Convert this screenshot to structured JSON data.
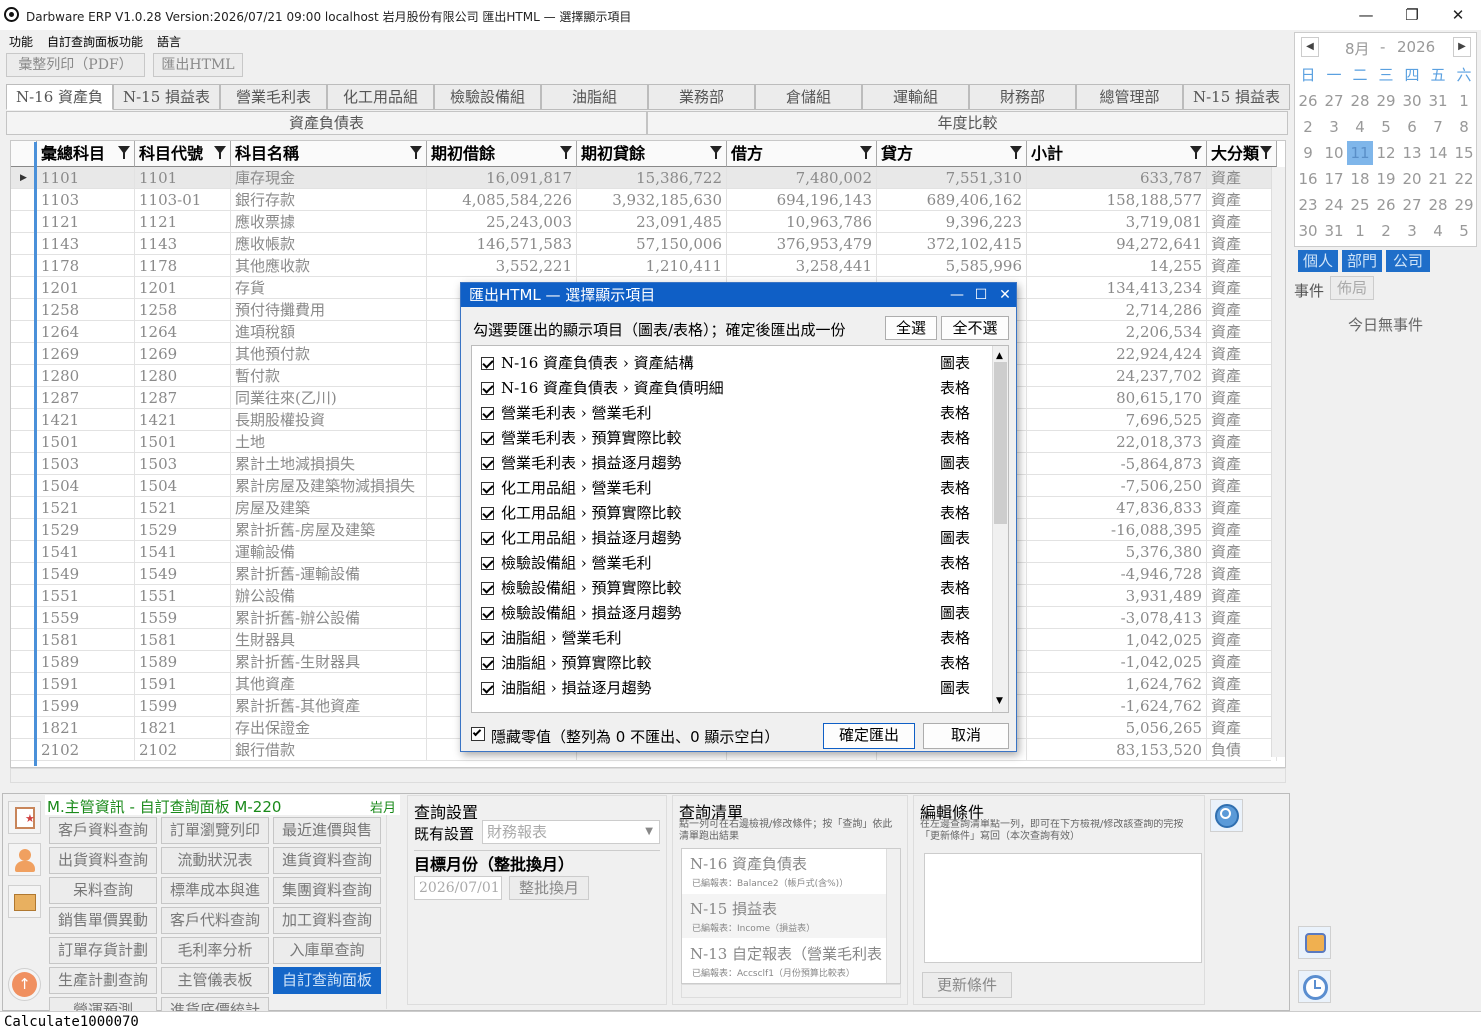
{
  "window": {
    "title": "Darbware ERP V1.0.28 Version:2026/07/21 09:00   localhost 岩月股份有限公司 匯出HTML — 選擇顯示項目",
    "minimize": "—",
    "maximize": "❐",
    "close": "✕"
  },
  "menu": [
    "功能",
    "自訂查詢面板功能",
    "語言"
  ],
  "toolbar": {
    "print": "彙整列印（PDF）",
    "export_html": "匯出HTML"
  },
  "tabs": [
    "N-16 資產負",
    "N-15 損益表",
    "營業毛利表",
    "化工用品組",
    "檢驗設備組",
    "油脂組",
    "業務部",
    "倉儲組",
    "運輸組",
    "財務部",
    "總管理部",
    "N-15 損益表"
  ],
  "group_headers": {
    "left": "資產負債表",
    "right": "年度比較"
  },
  "grid": {
    "columns": [
      "彙總科目",
      "科目代號",
      "科目名稱",
      "期初借餘",
      "期初貸餘",
      "借方",
      "貸方",
      "小計",
      "大分類"
    ],
    "row_marker": "▶",
    "rows": [
      [
        "1101",
        "1101",
        "庫存現金",
        "16,091,817",
        "15,386,722",
        "7,480,002",
        "7,551,310",
        "633,787",
        "資產"
      ],
      [
        "1103",
        "1103-01",
        "銀行存款",
        "4,085,584,226",
        "3,932,185,630",
        "694,196,143",
        "689,406,162",
        "158,188,577",
        "資產"
      ],
      [
        "1121",
        "1121",
        "應收票據",
        "25,243,003",
        "23,091,485",
        "10,963,786",
        "9,396,223",
        "3,719,081",
        "資產"
      ],
      [
        "1143",
        "1143",
        "應收帳款",
        "146,571,583",
        "57,150,006",
        "376,953,479",
        "372,102,415",
        "94,272,641",
        "資產"
      ],
      [
        "1178",
        "1178",
        "其他應收款",
        "3,552,221",
        "1,210,411",
        "3,258,441",
        "5,585,996",
        "14,255",
        "資產"
      ],
      [
        "1201",
        "1201",
        "存貨",
        "",
        "",
        "",
        "",
        "134,413,234",
        "資產"
      ],
      [
        "1258",
        "1258",
        "預付待攤費用",
        "",
        "",
        "",
        "",
        "2,714,286",
        "資產"
      ],
      [
        "1264",
        "1264",
        "進項稅額",
        "",
        "",
        "",
        "",
        "2,206,534",
        "資產"
      ],
      [
        "1269",
        "1269",
        "其他預付款",
        "",
        "",
        "",
        "",
        "22,924,424",
        "資產"
      ],
      [
        "1280",
        "1280",
        "暫付款",
        "",
        "",
        "",
        "",
        "24,237,702",
        "資產"
      ],
      [
        "1287",
        "1287",
        "同業往來(乙川)",
        "",
        "",
        "",
        "",
        "80,615,170",
        "資產"
      ],
      [
        "1421",
        "1421",
        "長期股權投資",
        "",
        "",
        "",
        "",
        "7,696,525",
        "資產"
      ],
      [
        "1501",
        "1501",
        "土地",
        "",
        "",
        "",
        "",
        "22,018,373",
        "資產"
      ],
      [
        "1503",
        "1503",
        "累計土地減損損失",
        "",
        "",
        "",
        "",
        "-5,864,873",
        "資產"
      ],
      [
        "1504",
        "1504",
        "累計房屋及建築物減損損失",
        "",
        "",
        "",
        "",
        "-7,506,250",
        "資產"
      ],
      [
        "1521",
        "1521",
        "房屋及建築",
        "",
        "",
        "",
        "",
        "47,836,833",
        "資產"
      ],
      [
        "1529",
        "1529",
        "累計折舊-房屋及建築",
        "",
        "",
        "",
        "",
        "-16,088,395",
        "資產"
      ],
      [
        "1541",
        "1541",
        "運輸設備",
        "",
        "",
        "",
        "",
        "5,376,380",
        "資產"
      ],
      [
        "1549",
        "1549",
        "累計折舊-運輸設備",
        "",
        "",
        "",
        "",
        "-4,946,728",
        "資產"
      ],
      [
        "1551",
        "1551",
        "辦公設備",
        "",
        "",
        "",
        "",
        "3,931,489",
        "資產"
      ],
      [
        "1559",
        "1559",
        "累計折舊-辦公設備",
        "",
        "",
        "",
        "",
        "-3,078,413",
        "資產"
      ],
      [
        "1581",
        "1581",
        "生財器具",
        "",
        "",
        "",
        "",
        "1,042,025",
        "資產"
      ],
      [
        "1589",
        "1589",
        "累計折舊-生財器具",
        "",
        "",
        "",
        "",
        "-1,042,025",
        "資產"
      ],
      [
        "1591",
        "1591",
        "其他資產",
        "",
        "",
        "",
        "",
        "1,624,762",
        "資產"
      ],
      [
        "1599",
        "1599",
        "累計折舊-其他資產",
        "",
        "",
        "",
        "",
        "-1,624,762",
        "資產"
      ],
      [
        "1821",
        "1821",
        "存出保證金",
        "",
        "",
        "",
        "",
        "5,056,265",
        "資產"
      ],
      [
        "2102",
        "2102",
        "銀行借款",
        "",
        "",
        "",
        "",
        "83,153,520",
        "負債"
      ]
    ]
  },
  "dialog": {
    "title": "匯出HTML — 選擇顯示項目",
    "prompt": "勾選要匯出的顯示項目（圖表/表格）；確定後匯出成一份",
    "select_all": "全選",
    "select_none": "全不選",
    "items": [
      {
        "label": "N-16 資產負債表 › 資產結構",
        "kind": "圖表"
      },
      {
        "label": "N-16 資產負債表 › 資產負債明細",
        "kind": "表格"
      },
      {
        "label": "營業毛利表 › 營業毛利",
        "kind": "表格"
      },
      {
        "label": "營業毛利表 › 預算實際比較",
        "kind": "表格"
      },
      {
        "label": "營業毛利表 › 損益逐月趨勢",
        "kind": "圖表"
      },
      {
        "label": "化工用品組 › 營業毛利",
        "kind": "表格"
      },
      {
        "label": "化工用品組 › 預算實際比較",
        "kind": "表格"
      },
      {
        "label": "化工用品組 › 損益逐月趨勢",
        "kind": "圖表"
      },
      {
        "label": "檢驗設備組 › 營業毛利",
        "kind": "表格"
      },
      {
        "label": "檢驗設備組 › 預算實際比較",
        "kind": "表格"
      },
      {
        "label": "檢驗設備組 › 損益逐月趨勢",
        "kind": "圖表"
      },
      {
        "label": "油脂組 › 營業毛利",
        "kind": "表格"
      },
      {
        "label": "油脂組 › 預算實際比較",
        "kind": "表格"
      },
      {
        "label": "油脂組 › 損益逐月趨勢",
        "kind": "圖表"
      }
    ],
    "hide_zero": "隱藏零值（整列為 0 不匯出、0 顯示空白）",
    "ok": "確定匯出",
    "cancel": "取消"
  },
  "calendar": {
    "month": "8月",
    "sep": "-",
    "year": "2026",
    "weekdays": [
      "日",
      "一",
      "二",
      "三",
      "四",
      "五",
      "六"
    ],
    "days": [
      [
        "26",
        "27",
        "28",
        "29",
        "30",
        "31",
        "1"
      ],
      [
        "2",
        "3",
        "4",
        "5",
        "6",
        "7",
        "8"
      ],
      [
        "9",
        "10",
        "11",
        "12",
        "13",
        "14",
        "15"
      ],
      [
        "16",
        "17",
        "18",
        "19",
        "20",
        "21",
        "22"
      ],
      [
        "23",
        "24",
        "25",
        "26",
        "27",
        "28",
        "29"
      ],
      [
        "30",
        "31",
        "1",
        "2",
        "3",
        "4",
        "5"
      ]
    ],
    "today": "11"
  },
  "events": {
    "tabs": [
      "個人",
      "部門",
      "公司"
    ],
    "label": "事件",
    "layout": "佈局",
    "empty": "今日無事件"
  },
  "panel": {
    "title": "M.主管資訊 - 自訂查詢面板  M-220",
    "company": "岩月",
    "buttons": [
      [
        "客戶資料查詢",
        "訂單瀏覽列印",
        "最近進價與售"
      ],
      [
        "出貨資料查詢",
        "流動狀況表",
        "進貨資料查詢"
      ],
      [
        "呆料查詢",
        "標準成本與進",
        "集團資料查詢"
      ],
      [
        "銷售單價異動",
        "客戶代料查詢",
        "加工資料查詢"
      ],
      [
        "訂單存貨計劃",
        "毛利率分析",
        "入庫單查詢"
      ],
      [
        "生產計劃查詢",
        "主管儀表板",
        "自訂查詢面板"
      ],
      [
        "營運預測",
        "進貨底價統計",
        ""
      ]
    ]
  },
  "query": {
    "title": "查詢設置",
    "existing_label": "既有設置",
    "existing_value": "財務報表",
    "month_label": "目標月份（整批換月）",
    "month_value": "2026/07/01",
    "switch": "整批換月"
  },
  "qlist": {
    "title": "查詢清單",
    "hint": "點一列可在右邊檢視/修改條件；按「查詢」依此清單跑出結果",
    "items": [
      {
        "name": "N-16 資產負債表",
        "sub": "已編報表：Balance2（帳戶式(含%)）"
      },
      {
        "name": "N-15 損益表",
        "sub": "已編報表：Income（損益表）"
      },
      {
        "name": "N-13 自定報表（營業毛利表",
        "sub": "已編報表：Accsclf1（月份預算比較表）"
      }
    ]
  },
  "edit": {
    "title": "編輯條件",
    "hint": "在左邊查詢清單點一列，即可在下方檢視/修改該查詢的完按「更新條件」寫回（本次查詢有效）",
    "update": "更新條件"
  },
  "status": "Calculate1000070"
}
